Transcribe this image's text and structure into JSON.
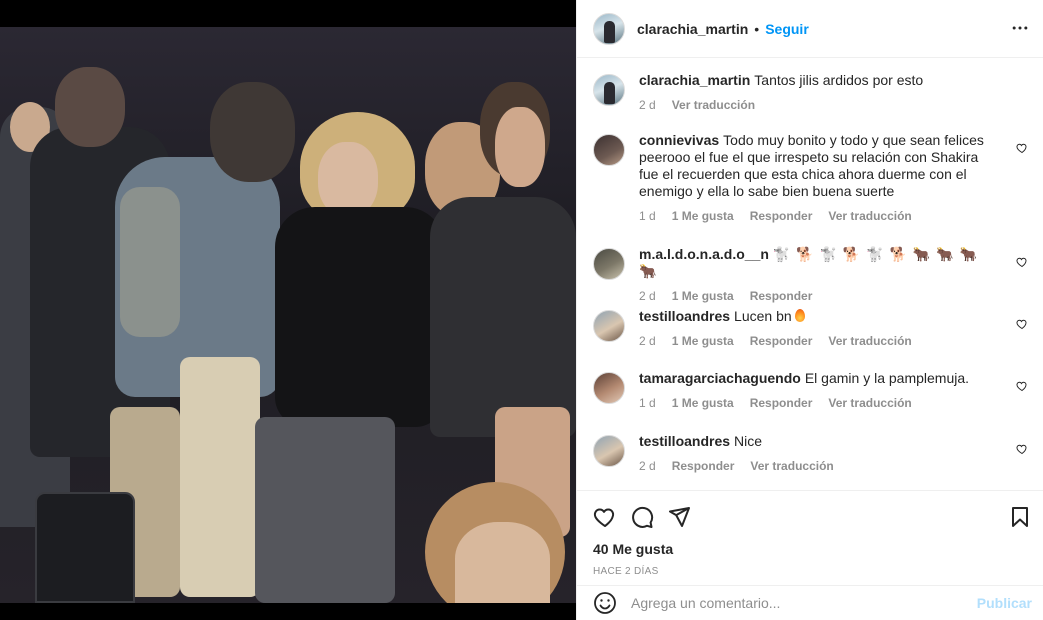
{
  "colors": {
    "link": "#0095f6",
    "muted": "#8e8e8e",
    "text": "#262626",
    "publish_disabled": "#b2dffc"
  },
  "header": {
    "username": "clarachia_martin",
    "separator": "•",
    "follow_label": "Seguir",
    "more_icon": "more-horizontal-icon"
  },
  "caption": {
    "username": "clarachia_martin",
    "text": "Tantos jilis ardidos por esto",
    "time": "2 d",
    "translate": "Ver traducción"
  },
  "comments": [
    {
      "username": "connievivas",
      "text": "Todo muy bonito y todo y que sean felices peerooo el fue el que irrespeto su relación con Shakira fue el recuerden que esta chica ahora duerme con el enemigo y ella lo sabe bien buena suerte",
      "time": "1 d",
      "likes": "1 Me gusta",
      "reply": "Responder",
      "translate": "Ver traducción"
    },
    {
      "username": "m.a.l.d.o.n.a.d.o__n",
      "text": "🐩 🐕 🐩 🐕 🐩 🐕 🐂 🐂 🐂 🐂",
      "time": "2 d",
      "likes": "1 Me gusta",
      "reply": "Responder"
    },
    {
      "username": "testilloandres",
      "text": "Lucen bn",
      "emoji": "fire-emoji",
      "time": "2 d",
      "likes": "1 Me gusta",
      "reply": "Responder",
      "translate": "Ver traducción"
    },
    {
      "username": "tamaragarciachaguendo",
      "text": "El gamin y la pamplemuja.",
      "time": "1 d",
      "likes": "1 Me gusta",
      "reply": "Responder",
      "translate": "Ver traducción"
    },
    {
      "username": "testilloandres",
      "text": "Nice",
      "time": "2 d",
      "reply": "Responder",
      "translate": "Ver traducción"
    }
  ],
  "actions": {
    "icons": [
      "heart-icon",
      "comment-icon",
      "share-icon",
      "bookmark-icon"
    ]
  },
  "likes_total": "40 Me gusta",
  "posted": "HACE 2 DÍAS",
  "add_comment": {
    "placeholder": "Agrega un comentario...",
    "publish_label": "Publicar"
  }
}
